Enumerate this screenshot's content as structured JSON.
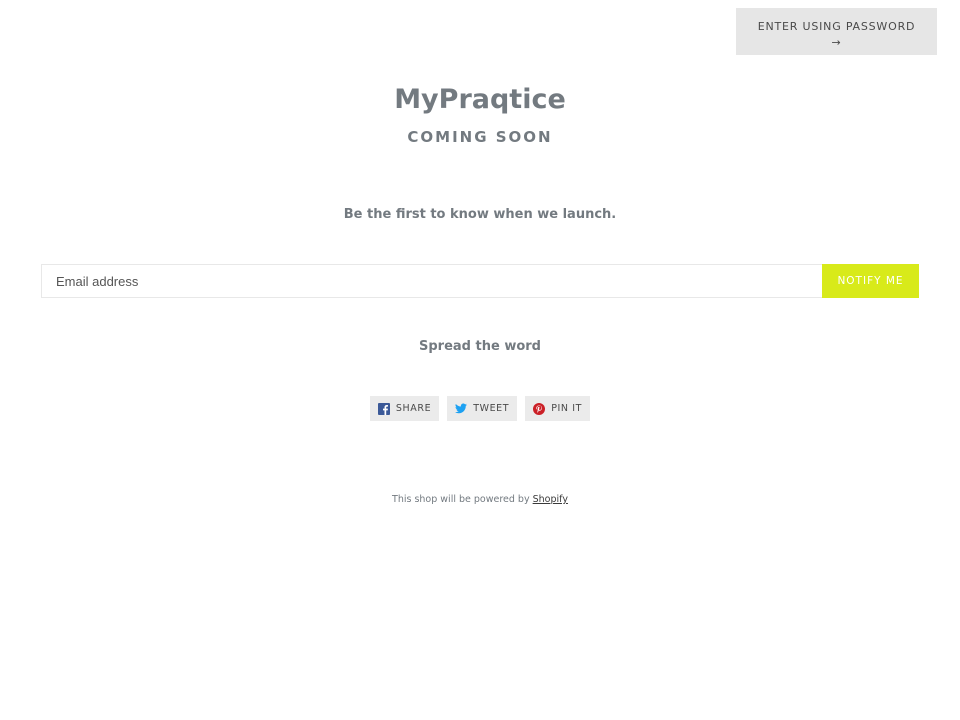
{
  "header": {
    "password_button_label": "Enter using password",
    "password_button_arrow": "→"
  },
  "hero": {
    "shop_name": "MyPraqtice",
    "status": "Coming Soon",
    "tagline": "Be the first to know when we launch."
  },
  "signup": {
    "email_placeholder": "Email address",
    "email_value": "",
    "submit_label": "Notify me"
  },
  "social": {
    "heading": "Spread the word",
    "buttons": [
      {
        "label": "Share",
        "icon": "facebook-icon",
        "color": "#3b5998"
      },
      {
        "label": "Tweet",
        "icon": "twitter-icon",
        "color": "#1da1f2"
      },
      {
        "label": "Pin it",
        "icon": "pinterest-icon",
        "color": "#cb2027"
      }
    ]
  },
  "footer": {
    "text": "This shop will be powered by",
    "link_label": "Shopify"
  },
  "colors": {
    "accent": "#d8ea1a",
    "text": "#737a80",
    "button_bg": "#e6e6e6"
  }
}
